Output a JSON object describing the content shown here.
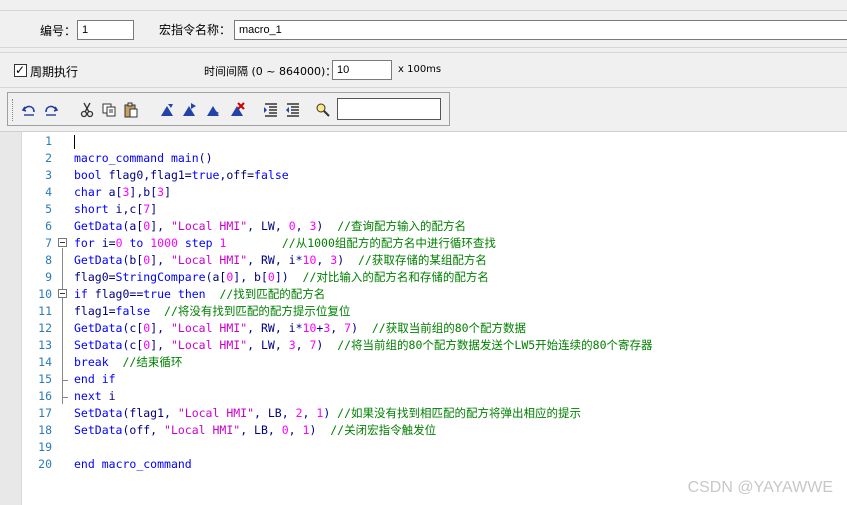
{
  "header": {
    "number_label": "编号：",
    "number_value": "1",
    "macro_name_label": "宏指令名称：",
    "macro_name_value": "macro_1"
  },
  "period": {
    "checkbox_label": "周期执行",
    "checked": true,
    "interval_label": "时间间隔 (0 ~ 864000)：",
    "interval_value": "10",
    "interval_unit": "x 100ms"
  },
  "toolbar": {
    "buttons": [
      "undo-icon",
      "redo-icon",
      "cut-icon",
      "copy-icon",
      "paste-icon",
      "bookmark-toggle-icon",
      "bookmark-next-icon",
      "bookmark-prev-icon",
      "bookmark-clear-icon",
      "indent-icon",
      "outdent-icon",
      "find-icon"
    ],
    "search_value": ""
  },
  "editor": {
    "line_numbers": [
      "1",
      "2",
      "3",
      "4",
      "5",
      "6",
      "7",
      "8",
      "9",
      "10",
      "11",
      "12",
      "13",
      "14",
      "15",
      "16",
      "17",
      "18",
      "19",
      "20"
    ],
    "lines": [
      "",
      "macro_command main()",
      "bool flag0,flag1=true,off=false",
      "char a[3],b[3]",
      "short i,c[7]",
      "GetData(a[0], \"Local HMI\", LW, 0, 3)  //查询配方输入的配方名",
      "for i=0 to 1000 step 1        //从1000组配方的配方名中进行循环查找",
      "GetData(b[0], \"Local HMI\", RW, i*10, 3)  //获取存储的某组配方名",
      "flag0=StringCompare(a[0], b[0])  //对比输入的配方名和存储的配方名",
      "if flag0==true then  //找到匹配的配方名",
      "flag1=false  //将没有找到匹配的配方提示位复位",
      "GetData(c[0], \"Local HMI\", RW, i*10+3, 7)  //获取当前组的80个配方数据",
      "SetData(c[0], \"Local HMI\", LW, 3, 7)  //将当前组的80个配方数据发送个LW5开始连续的80个寄存器",
      "break  //结束循环",
      "end if",
      "next i",
      "SetData(flag1, \"Local HMI\", LB, 2, 1) //如果没有找到相匹配的配方将弹出相应的提示",
      "SetData(off, \"Local HMI\", LB, 0, 1)  //关闭宏指令触发位",
      "",
      "end macro_command"
    ]
  },
  "watermark": "CSDN @YAYAWWE",
  "colors": {
    "keyword": "#0000ff",
    "string": "#cc00cc",
    "number": "#ff00ff",
    "comment": "#008000",
    "identifier": "#000080",
    "line_number": "#2b7bb9"
  }
}
